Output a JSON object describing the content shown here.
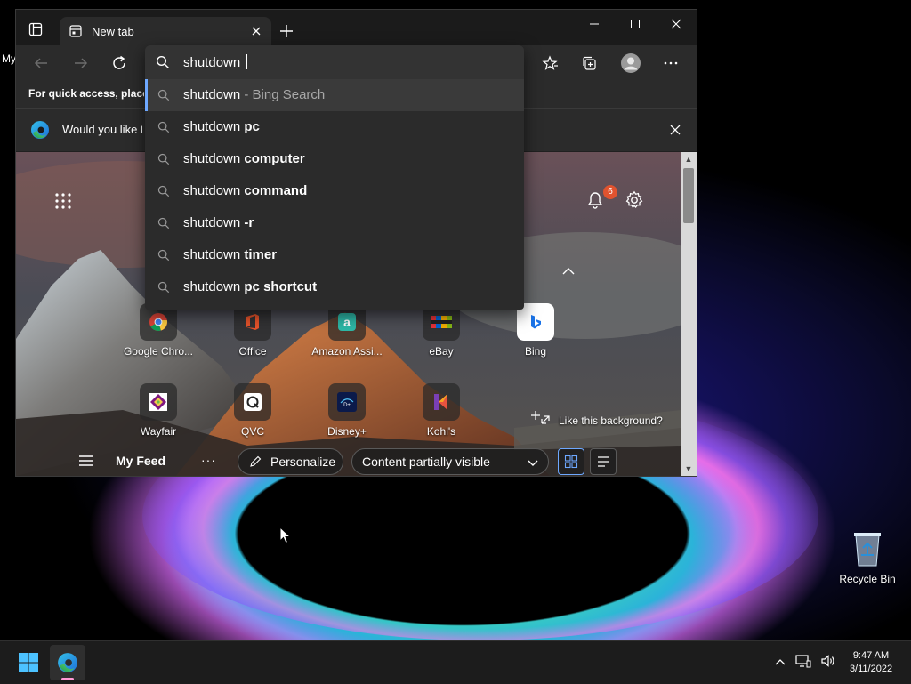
{
  "desktop": {
    "partial_label": "My",
    "recycle_bin_label": "Recycle Bin"
  },
  "browser": {
    "tab_title": "New tab",
    "favorites_bar_text": "For quick access, place y",
    "infobar_text": "Would you like t",
    "address_value": "shutdown ",
    "suggestions": [
      {
        "prefix": "shutdown",
        "bold": "",
        "suffix": " - Bing Search"
      },
      {
        "prefix": "shutdown ",
        "bold": "pc",
        "suffix": ""
      },
      {
        "prefix": "shutdown ",
        "bold": "computer",
        "suffix": ""
      },
      {
        "prefix": "shutdown ",
        "bold": "command",
        "suffix": ""
      },
      {
        "prefix": "shutdown ",
        "bold": "-r",
        "suffix": ""
      },
      {
        "prefix": "shutdown ",
        "bold": "timer",
        "suffix": ""
      },
      {
        "prefix": "shutdown ",
        "bold": "pc shortcut",
        "suffix": ""
      }
    ],
    "notification_count": "6",
    "quick_links_row1": [
      "Google Chro...",
      "Office",
      "Amazon Assi...",
      "eBay",
      "Bing"
    ],
    "quick_links_row2": [
      "Wayfair",
      "QVC",
      "Disney+",
      "Kohl's"
    ],
    "like_background": "Like this background?",
    "feed": {
      "title": "My Feed",
      "more": "···",
      "personalize": "Personalize",
      "content_visibility": "Content partially visible"
    }
  },
  "taskbar": {
    "time": "9:47 AM",
    "date": "3/11/2022"
  },
  "colors": {
    "accent": "#6ea8ff",
    "badge": "#e0532f",
    "running_indicator": "#ff9ad5"
  }
}
